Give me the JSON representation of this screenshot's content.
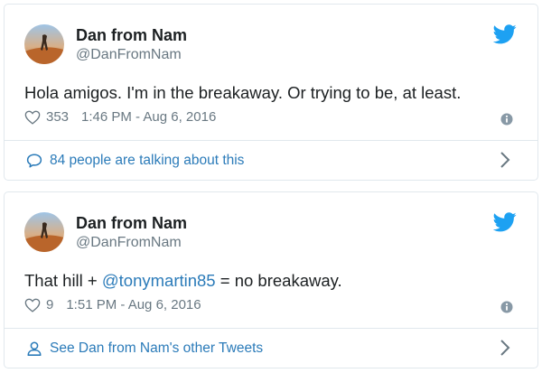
{
  "tweets": [
    {
      "author_name": "Dan from Nam",
      "handle": "@DanFromNam",
      "text_before": "Hola amigos. I'm in the breakaway. Or trying to be, at least.",
      "mention": "",
      "text_after": "",
      "likes": "353",
      "timestamp": "1:46 PM - Aug 6, 2016",
      "footer_label": "84 people are talking about this",
      "footer_icon": "comment-icon"
    },
    {
      "author_name": "Dan from Nam",
      "handle": "@DanFromNam",
      "text_before": "That hill + ",
      "mention": "@tonymartin85",
      "text_after": " = no breakaway.",
      "likes": "9",
      "timestamp": "1:51 PM - Aug 6, 2016",
      "footer_label": "See Dan from Nam's other Tweets",
      "footer_icon": "person-icon"
    }
  ],
  "colors": {
    "link": "#2b7bb9",
    "secondary_text": "#697882",
    "border": "#e1e8ed",
    "twitter_blue": "#1da1f2"
  }
}
